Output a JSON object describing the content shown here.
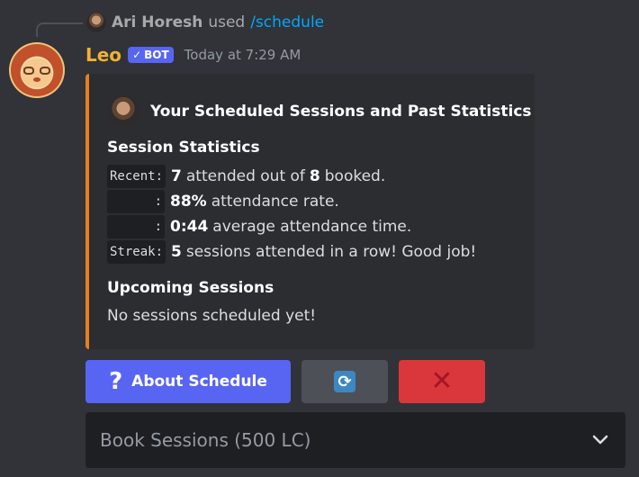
{
  "interaction": {
    "user": "Ari Horesh",
    "used_text": "used",
    "command": "/schedule"
  },
  "message": {
    "author": "Leo",
    "bot_tag": "BOT",
    "timestamp": "Today at 7:29 AM"
  },
  "embed": {
    "accent_color": "#e67e22",
    "author_name": "Your Scheduled Sessions and Past Statistics",
    "stats_title": "Session Statistics",
    "stats": [
      {
        "label": "Recent:",
        "v1": "7",
        "t1": "attended out of",
        "v2": "8",
        "t2": "booked."
      },
      {
        "label": ":",
        "v1": "88%",
        "t1": "attendance rate."
      },
      {
        "label": ":",
        "v1": "0:44",
        "t1": "average attendance time."
      },
      {
        "label": "Streak:",
        "v1": "5",
        "t1": "sessions attended in a row! Good job!"
      }
    ],
    "upcoming_title": "Upcoming Sessions",
    "upcoming_text": "No sessions scheduled yet!"
  },
  "buttons": {
    "about_icon": "?",
    "about_label": "About Schedule",
    "refresh_icon": "refresh-icon",
    "close_icon": "x-icon"
  },
  "select": {
    "placeholder": "Book Sessions (500 LC)"
  },
  "colors": {
    "background": "#313338",
    "blurple": "#5865f2",
    "danger": "#da373c",
    "secondary": "#4e5058",
    "bot_name": "#f0b232",
    "link": "#00a8fc"
  }
}
